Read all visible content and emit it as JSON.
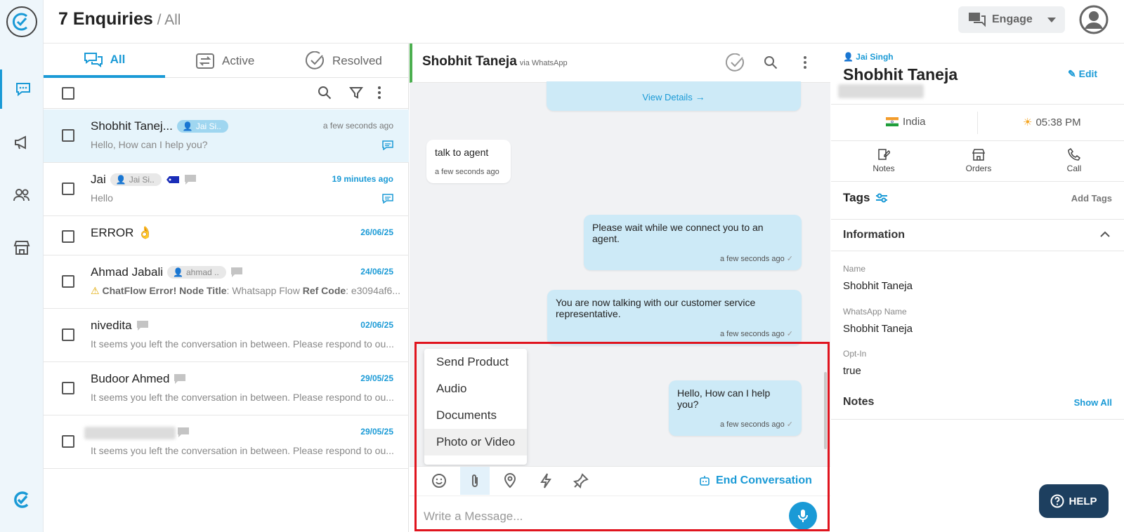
{
  "header": {
    "title": "7 Enquiries",
    "sub": " / All",
    "engage": "Engage"
  },
  "tabs": {
    "all": "All",
    "active": "Active",
    "resolved": "Resolved"
  },
  "conversations": [
    {
      "name": "Shobhit Tanej...",
      "chip": "Jai Si..",
      "time": "a few seconds ago",
      "msg": "Hello, How can I help you?"
    },
    {
      "name": "Jai",
      "chip": "Jai Si..",
      "time": "19 minutes ago",
      "msg": "Hello"
    },
    {
      "name": "ERROR",
      "emoji": "👌",
      "time": "26/06/25",
      "msg": ""
    },
    {
      "name": "Ahmad Jabali",
      "chip": "ahmad ..",
      "time": "24/06/25",
      "msg_b1": "ChatFlow Error! Node Title",
      "msg_t1": ": Whatsapp Flow ",
      "msg_b2": "Ref Code",
      "msg_t2": ": e3094af6..."
    },
    {
      "name": "nivedita",
      "time": "02/06/25",
      "msg": "It seems you left the conversation in between. Please respond to ou..."
    },
    {
      "name": "Budoor Ahmed",
      "time": "29/05/25",
      "msg": "It seems you left the conversation in between. Please respond to ou..."
    },
    {
      "name": "",
      "time": "29/05/25",
      "msg": "It seems you left the conversation in between. Please respond to ou..."
    }
  ],
  "chat": {
    "contact": "Shobhit Taneja",
    "via": "via WhatsApp",
    "view_details": "View Details",
    "messages": [
      {
        "text": "talk to agent",
        "time": "a few seconds ago"
      },
      {
        "text": "Please wait while we connect you to an agent.",
        "time": "a few seconds ago"
      },
      {
        "text": "You are now talking with our customer service representative.",
        "time": "a few seconds ago"
      },
      {
        "text": "Hello, How can I help you?",
        "time": "a few seconds ago"
      }
    ],
    "attach_menu": [
      "Send Product",
      "Audio",
      "Documents",
      "Photo or Video"
    ],
    "end_conversation": "End Conversation",
    "placeholder": "Write a Message..."
  },
  "info": {
    "agent": "Jai Singh",
    "name": "Shobhit Taneja",
    "edit": "Edit",
    "country": "India",
    "local_time": "05:38 PM",
    "actions": [
      "Notes",
      "Orders",
      "Call"
    ],
    "tags_label": "Tags",
    "add_tags": "Add Tags",
    "information_label": "Information",
    "fields": [
      {
        "label": "Name",
        "value": "Shobhit Taneja"
      },
      {
        "label": "WhatsApp Name",
        "value": "Shobhit Taneja"
      },
      {
        "label": "Opt-In",
        "value": "true"
      }
    ],
    "notes_label": "Notes",
    "show_all": "Show All"
  },
  "help": "HELP",
  "colors": {
    "accent": "#1a9ad6",
    "outgoing": "#cdeaf7",
    "highlight": "#e0141e"
  }
}
